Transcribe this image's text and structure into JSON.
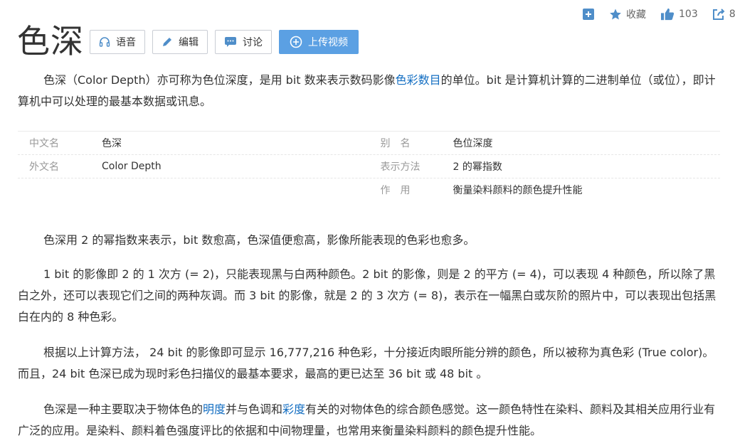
{
  "topbar": {
    "favorite_label": "收藏",
    "like_count": "103",
    "share_count": "8"
  },
  "title": "色深",
  "buttons": {
    "voice": "语音",
    "edit": "编辑",
    "discuss": "讨论",
    "upload": "上传视频"
  },
  "summary": {
    "part1": "色深（Color Depth）亦可称为色位深度，是用 bit 数来表示数码影像",
    "link": "色彩数目",
    "part2": "的单位。bit 是计算机计算的二进制单位（或位），即计算机中可以处理的最基本数据或讯息。"
  },
  "infobox": {
    "rows": [
      [
        {
          "label": "中文名",
          "value": "色深"
        },
        {
          "label": "别　名",
          "value": "色位深度"
        }
      ],
      [
        {
          "label": "外文名",
          "value": "Color Depth"
        },
        {
          "label": "表示方法",
          "value": " 2 的幂指数"
        }
      ],
      [
        null,
        {
          "label": "作　用",
          "value": "衡量染料颜料的颜色提升性能"
        }
      ]
    ]
  },
  "body": {
    "p1": "色深用 2 的幂指数来表示，bit 数愈高，色深值便愈高，影像所能表现的色彩也愈多。",
    "p2": "1 bit 的影像即 2 的 1 次方 (= 2)，只能表现黑与白两种颜色。2 bit 的影像，则是 2 的平方 (= 4)，可以表现 4 种颜色，所以除了黑白之外，还可以表现它们之间的两种灰调。而 3 bit 的影像，就是 2 的 3 次方 (= 8)，表示在一幅黑白或灰阶的照片中，可以表现出包括黑白在内的 8 种色彩。",
    "p3": "根据以上计算方法， 24 bit 的影像即可显示 16,777,216 种色彩，十分接近肉眼所能分辨的颜色，所以被称为真色彩 (True color)。而且，24 bit 色深已成为现时彩色扫描仪的最基本要求，最高的更已达至 36 bit 或 48 bit 。",
    "p4_a": "色深是一种主要取决于物体色的",
    "p4_link1": "明度",
    "p4_b": "并与色调和",
    "p4_link2": "彩度",
    "p4_c": "有关的对物体色的综合颜色感觉。这一颜色特性在染料、颜料及其相关应用行业有广泛的应用。是染料、颜料着色强度评比的依据和中间物理量，也常用来衡量染料颜料的颜色提升性能。"
  },
  "colors": {
    "link": "#136ec2",
    "accent": "#5ba0e3",
    "icon": "#4f8ec9"
  }
}
